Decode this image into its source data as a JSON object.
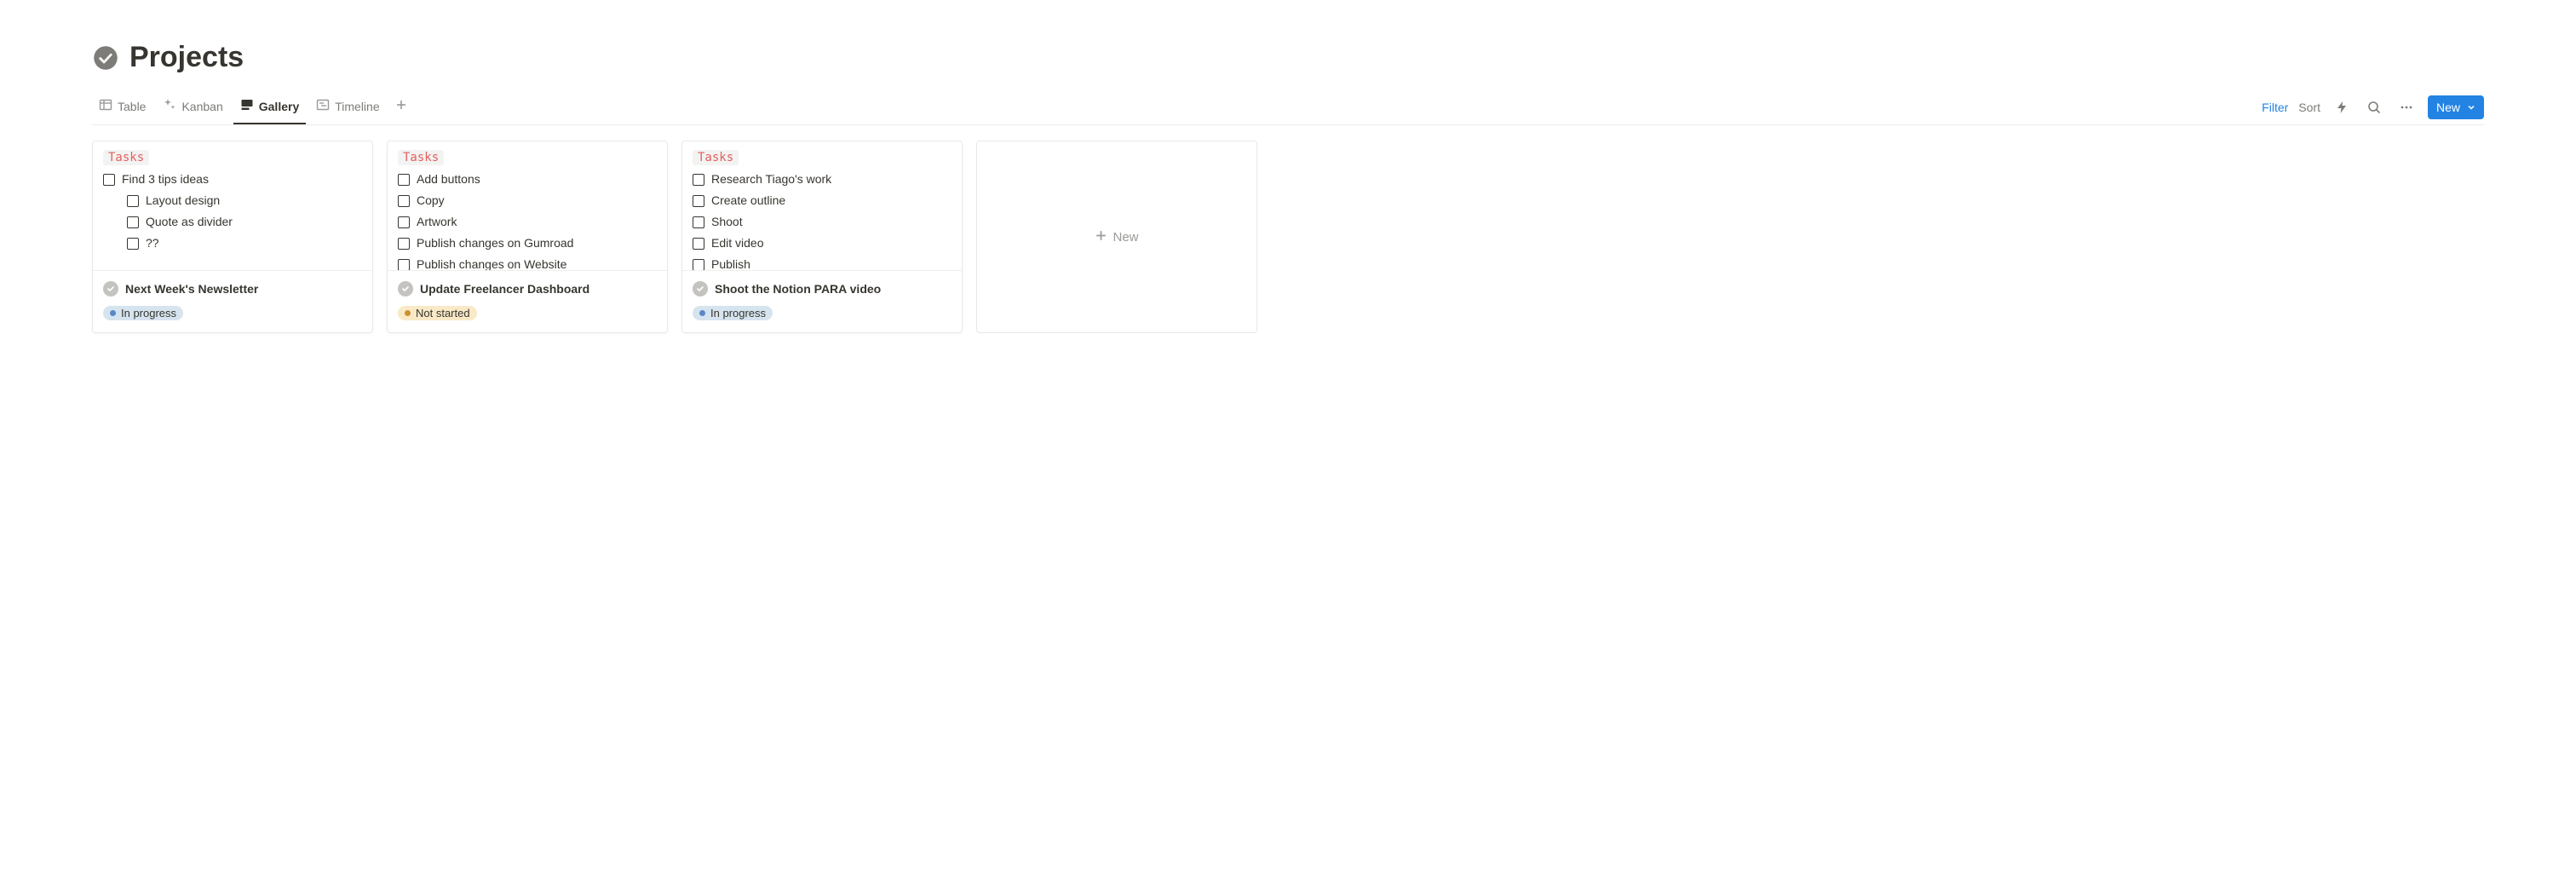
{
  "page": {
    "title": "Projects"
  },
  "views": {
    "tabs": [
      {
        "label": "Table"
      },
      {
        "label": "Kanban"
      },
      {
        "label": "Gallery"
      },
      {
        "label": "Timeline"
      }
    ]
  },
  "toolbar": {
    "filter": "Filter",
    "sort": "Sort",
    "new_label": "New"
  },
  "tasks_heading": "Tasks",
  "cards": [
    {
      "title": "Next Week's Newsletter",
      "status": {
        "label": "In progress",
        "kind": "inprogress"
      },
      "tasks": [
        {
          "label": "Find 3 tips ideas",
          "indent": false
        },
        {
          "label": "Layout design",
          "indent": true
        },
        {
          "label": "Quote as divider",
          "indent": true
        },
        {
          "label": "??",
          "indent": true
        }
      ]
    },
    {
      "title": "Update Freelancer Dashboard",
      "status": {
        "label": "Not started",
        "kind": "notstarted"
      },
      "tasks": [
        {
          "label": "Add buttons",
          "indent": false
        },
        {
          "label": "Copy",
          "indent": false
        },
        {
          "label": "Artwork",
          "indent": false
        },
        {
          "label": "Publish changes on Gumroad",
          "indent": false
        },
        {
          "label": "Publish changes on Website",
          "indent": false
        }
      ]
    },
    {
      "title": "Shoot the Notion PARA video",
      "status": {
        "label": "In progress",
        "kind": "inprogress"
      },
      "tasks": [
        {
          "label": "Research Tiago's work",
          "indent": false
        },
        {
          "label": "Create outline",
          "indent": false
        },
        {
          "label": "Shoot",
          "indent": false
        },
        {
          "label": "Edit video",
          "indent": false
        },
        {
          "label": "Publish",
          "indent": false
        }
      ]
    }
  ],
  "new_card_label": "New"
}
